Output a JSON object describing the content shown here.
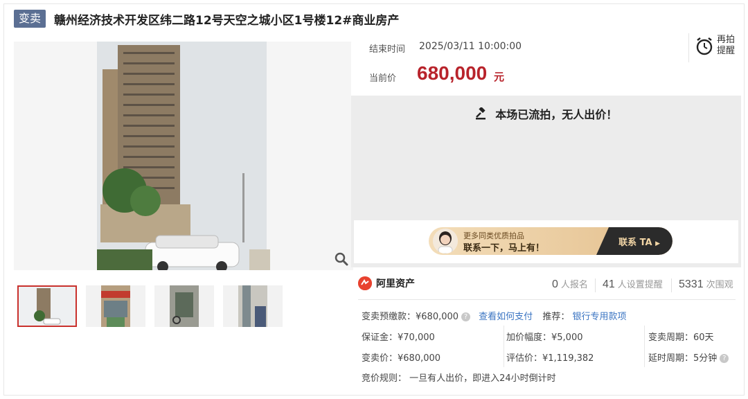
{
  "header": {
    "tag": "变卖",
    "title": "赣州经济技术开发区纬二路12号天空之城小区1号楼12#商业房产"
  },
  "auction": {
    "end_time_label": "结束时间",
    "end_time": "2025/03/11 10:00:00",
    "price_label": "当前价",
    "price": "680,000",
    "price_unit": "元",
    "remind_label": "再拍提醒"
  },
  "status": {
    "message": "本场已流拍，无人出价！"
  },
  "promo": {
    "line1": "更多同类优质拍品",
    "line2": "联系一下，马上有！",
    "cta": "联系 TA"
  },
  "stats": {
    "brand": "阿里资产",
    "signups_value": "0",
    "signups_label": "人报名",
    "reminders_value": "41",
    "reminders_label": "人设置提醒",
    "views_value": "5331",
    "views_label": "次围观"
  },
  "details": {
    "deposit_label": "变卖预缴款：¥680,000",
    "pay_link": "查看如何支付",
    "recommend_label": "推荐：",
    "recommend_link": "银行专用款项",
    "margin": "保证金：¥70,000",
    "increment": "加价幅度：¥5,000",
    "sale_period": "变卖周期：60天",
    "sale_price": "变卖价：¥680,000",
    "appraisal": "评估价：¥1,119,382",
    "delay_period": "延时周期：5分钟",
    "rule": "竞价规则：  一旦有人出价，即进入24小时倒计时"
  },
  "colors": {
    "accent_red": "#b8232b",
    "tag_blue": "#5b6f93",
    "link_blue": "#3a74c2"
  },
  "icons": [
    "zoom-icon",
    "alarm-clock-icon",
    "gavel-icon",
    "help-icon",
    "ali-logo-icon",
    "play-arrow-icon"
  ]
}
